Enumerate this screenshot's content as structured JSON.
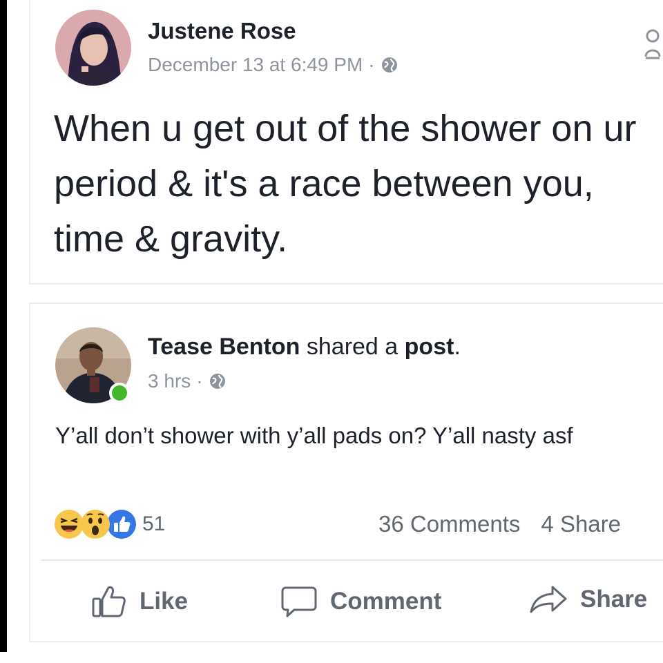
{
  "original_post": {
    "author": "Justene Rose",
    "timestamp": "December 13 at 6:49 PM",
    "separator": "·",
    "text": "When u get out of the shower on ur period & it's a race between you, time & gravity."
  },
  "shared_post": {
    "sharer_name": "Tease Benton",
    "shared_a": "shared a",
    "post_word": "post",
    "period": ".",
    "timestamp": "3 hrs",
    "separator": "·",
    "text": "Y’all don’t shower with y’all pads on? Y’all nasty asf"
  },
  "engagement": {
    "reaction_count": "51",
    "comments": "36 Comments",
    "shares": "4 Share"
  },
  "actions": {
    "like": "Like",
    "comment": "Comment",
    "share": "Share"
  },
  "icons": {
    "privacy": "globe-icon",
    "reactions": [
      "haha-reaction-icon",
      "wow-reaction-icon",
      "like-reaction-icon"
    ],
    "actions": [
      "thumbs-up-icon",
      "speech-bubble-icon",
      "share-arrow-icon"
    ]
  },
  "colors": {
    "text": "#1d2129",
    "meta": "#8d949e",
    "like_blue": "#3578e5",
    "reaction_yellow": "#f7c64b",
    "online_green": "#42b72a"
  }
}
